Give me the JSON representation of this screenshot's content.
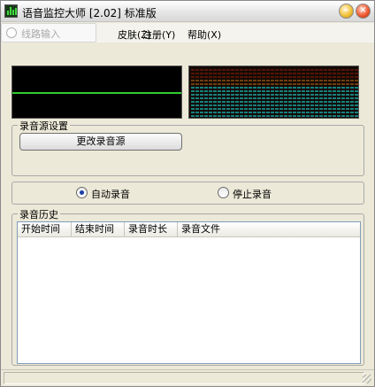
{
  "window": {
    "title": "语音监控大师 [2.02] 标准版",
    "icon": "equalizer-app-icon",
    "minimize_icon": "minimize-icon",
    "close_icon": "close-icon"
  },
  "menu": {
    "items": [
      {
        "label": "皮肤(Z)"
      },
      {
        "label": "注册(Y)"
      },
      {
        "label": "帮助(X)"
      }
    ],
    "overlay": {
      "label": "线路输入"
    }
  },
  "displays": {
    "scope_color": "#2ecc2e",
    "spectrum_palette": [
      "#8a1e0a",
      "#b86a14",
      "#1aa8a8"
    ]
  },
  "source_group": {
    "title": "录音源设置",
    "change_button": "更改录音源"
  },
  "mode_group": {
    "options": [
      {
        "label": "自动录音",
        "selected": true
      },
      {
        "label": "停止录音",
        "selected": false
      }
    ]
  },
  "history_group": {
    "title": "录音历史",
    "columns": [
      "开始时间",
      "结束时间",
      "录音时长",
      "录音文件"
    ],
    "rows": []
  },
  "statusbar": {
    "text": ""
  }
}
